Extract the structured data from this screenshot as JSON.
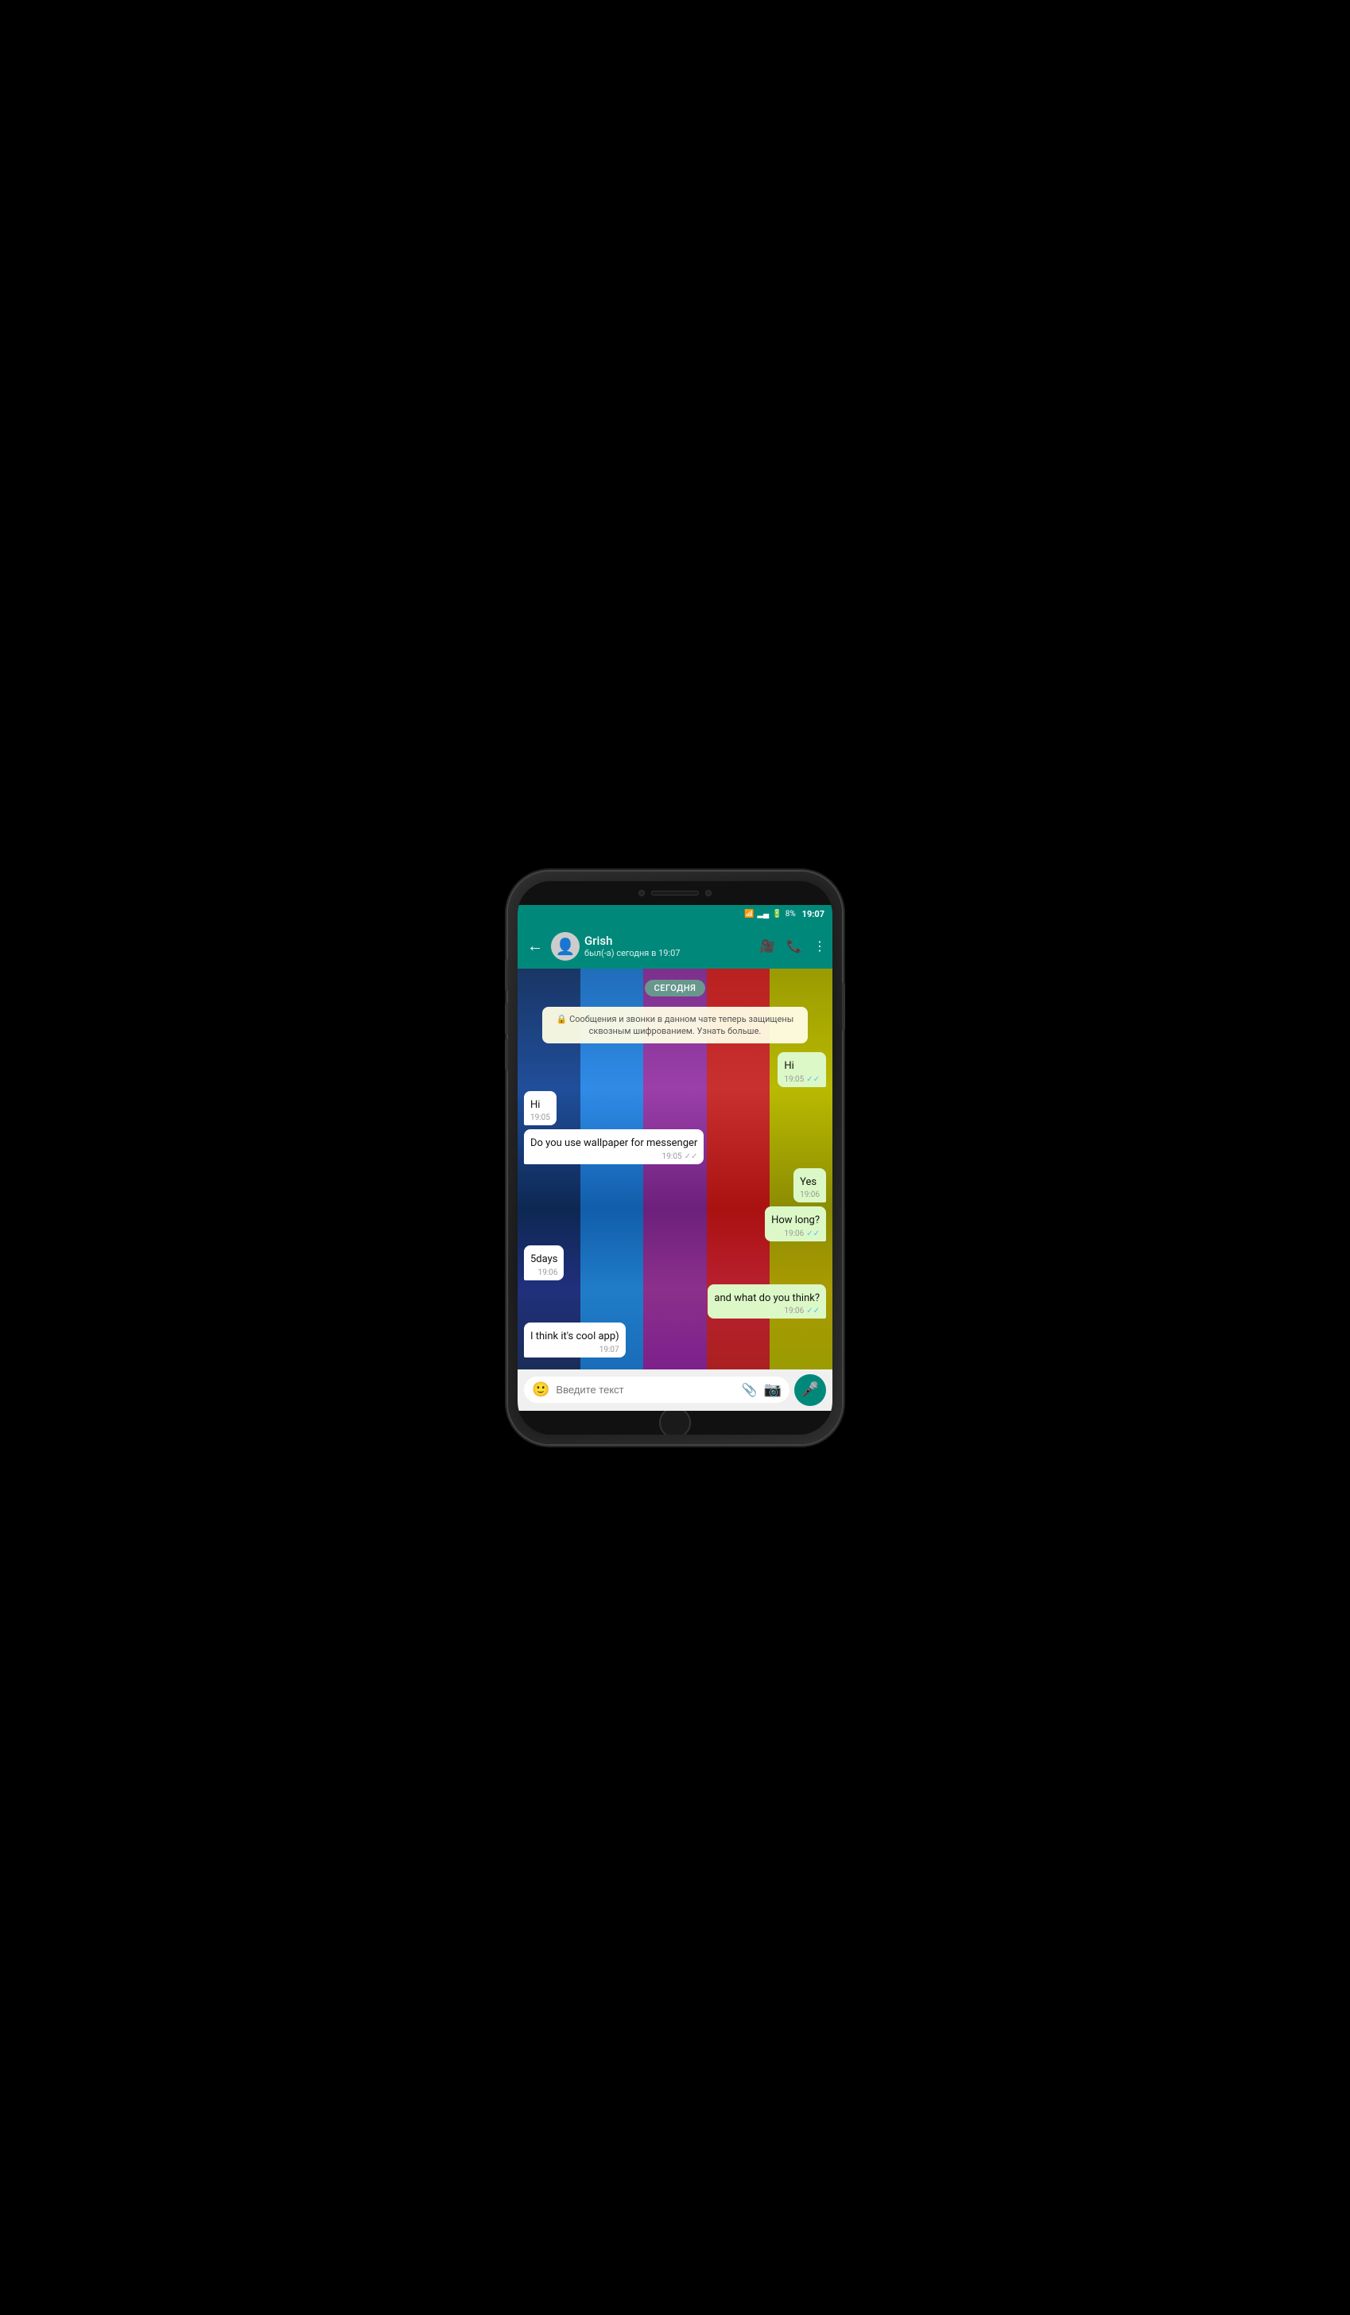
{
  "phone": {
    "status_bar": {
      "time": "19:07",
      "battery": "8%",
      "signal": "▂▄",
      "wifi": "wifi"
    },
    "header": {
      "back_label": "←",
      "contact_name": "Grish",
      "contact_status": "был(-а) сегодня в 19:07",
      "video_call_icon": "video",
      "call_icon": "call",
      "more_icon": "more"
    },
    "date_badge": "СЕГОДНЯ",
    "encryption_notice": "🔒 Сообщения и звонки в данном чате теперь защищены сквозным шифрованием. Узнать больше.",
    "messages": [
      {
        "id": 1,
        "type": "sent",
        "text": "Hi",
        "time": "19:05",
        "ticks": "✓✓"
      },
      {
        "id": 2,
        "type": "received",
        "text": "Hi",
        "time": "19:05"
      },
      {
        "id": 3,
        "type": "received",
        "text": "Do you use wallpaper for messenger",
        "time": "19:05",
        "ticks": "✓✓"
      },
      {
        "id": 4,
        "type": "sent",
        "text": "Yes",
        "time": "19:06"
      },
      {
        "id": 5,
        "type": "sent",
        "text": "How long?",
        "time": "19:06",
        "ticks": "✓✓"
      },
      {
        "id": 6,
        "type": "received",
        "text": "5days",
        "time": "19:06"
      },
      {
        "id": 7,
        "type": "sent",
        "text": "and what do you think?",
        "time": "19:06",
        "ticks": "✓✓"
      },
      {
        "id": 8,
        "type": "received",
        "text": "I think it's cool app)",
        "time": "19:07"
      }
    ],
    "input": {
      "placeholder": "Введите текст"
    }
  },
  "wood_strips": [
    {
      "color": "#2255AA"
    },
    {
      "color": "#3399FF"
    },
    {
      "color": "#AA44BB"
    },
    {
      "color": "#DD3333"
    },
    {
      "color": "#CCAA00"
    }
  ]
}
